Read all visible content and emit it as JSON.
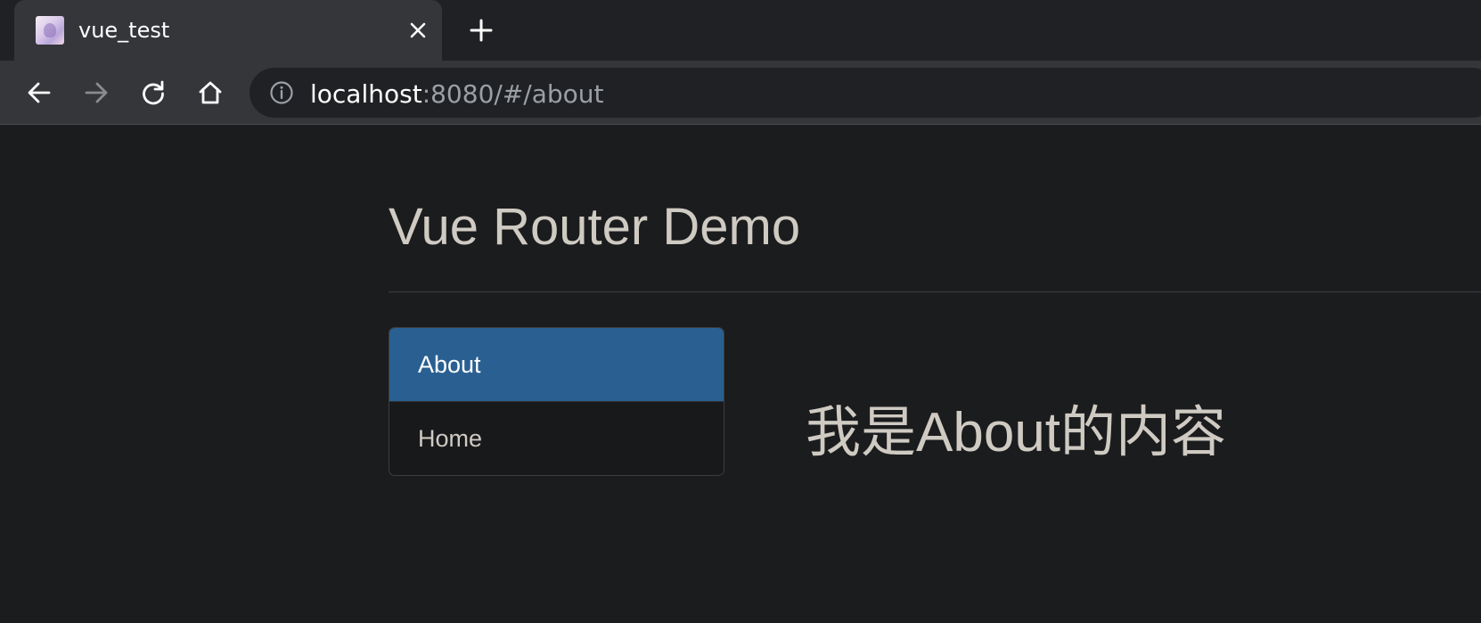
{
  "browser": {
    "tab": {
      "title": "vue_test"
    },
    "address": {
      "host": "localhost",
      "rest": ":8080/#/about"
    }
  },
  "page": {
    "title": "Vue Router Demo",
    "nav": [
      {
        "label": "About",
        "active": true
      },
      {
        "label": "Home",
        "active": false
      }
    ],
    "content": "我是About的内容"
  },
  "colors": {
    "accent": "#2a6091",
    "page_bg": "#1b1c1e",
    "text": "#cfcac2"
  }
}
